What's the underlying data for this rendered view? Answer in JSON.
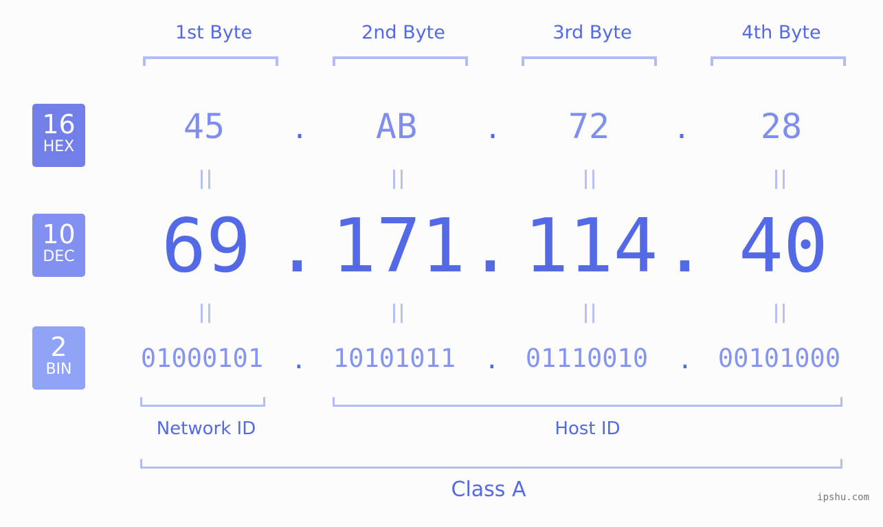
{
  "bytes": {
    "labels": [
      "1st Byte",
      "2nd Byte",
      "3rd Byte",
      "4th Byte"
    ]
  },
  "badges": {
    "hex": {
      "number": "16",
      "label": "HEX",
      "color": "#737fe9"
    },
    "dec": {
      "number": "10",
      "label": "DEC",
      "color": "#8190f1"
    },
    "bin": {
      "number": "2",
      "label": "BIN",
      "color": "#8fa4f8"
    }
  },
  "hex_values": [
    "45",
    "AB",
    "72",
    "28"
  ],
  "dec_values": [
    "69",
    "171",
    "114",
    "40"
  ],
  "bin_values": [
    "01000101",
    "10101011",
    "01110010",
    "00101000"
  ],
  "separator": ".",
  "network_id_label": "Network ID",
  "host_id_label": "Host ID",
  "class_label": "Class A",
  "watermark": "ipshu.com",
  "colors": {
    "accent": "#5469e6",
    "bracket": "#b4bcf6",
    "background": "#fbfcfb"
  }
}
